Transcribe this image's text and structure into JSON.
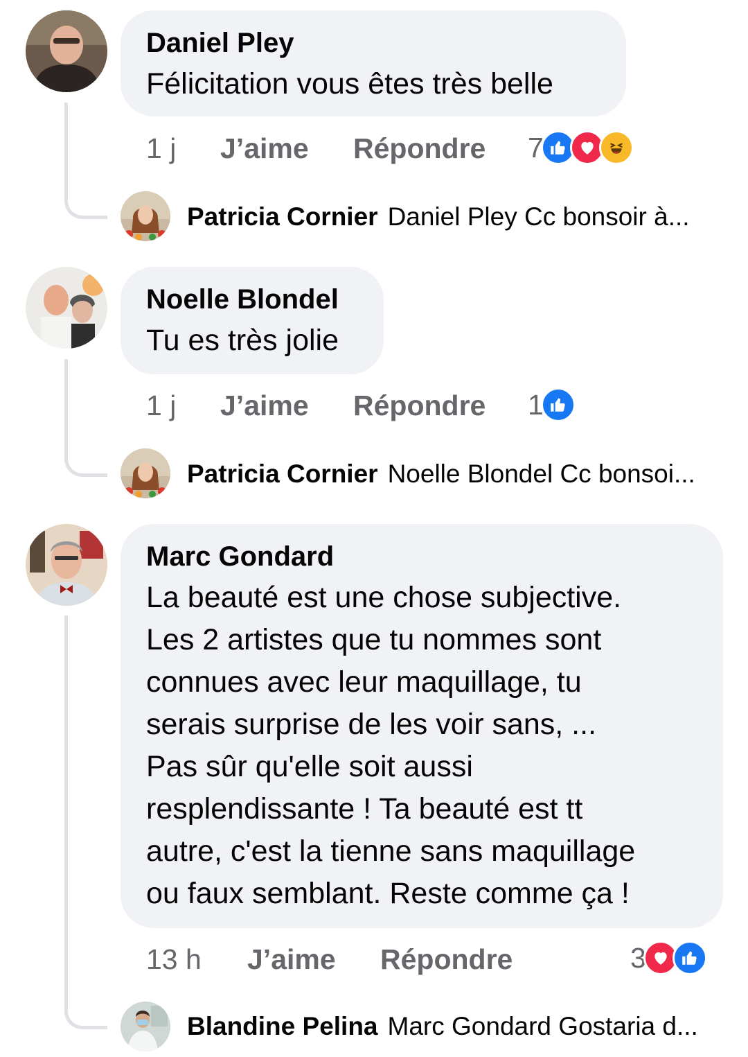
{
  "comments": [
    {
      "author": "Daniel Pley",
      "text": "Félicitation vous êtes très belle",
      "time": "1 j",
      "like_label": "J’aime",
      "reply_label": "Répondre",
      "reaction_count": "7",
      "reactions": [
        "like-icon",
        "love-icon",
        "haha-icon"
      ],
      "reply": {
        "author": "Patricia Cornier",
        "text": "Daniel Pley Cc bonsoir à..."
      }
    },
    {
      "author": "Noelle Blondel",
      "text": "Tu es très jolie",
      "time": "1 j",
      "like_label": "J’aime",
      "reply_label": "Répondre",
      "reaction_count": "1",
      "reactions": [
        "like-icon"
      ],
      "reply": {
        "author": "Patricia Cornier",
        "text": "Noelle Blondel  Cc bonsoi..."
      }
    },
    {
      "author": "Marc Gondard",
      "text": "La beauté est une chose subjective.\nLes 2 artistes que tu nommes sont\nconnues avec leur maquillage, tu\nserais surprise de les voir sans, ...\nPas sûr qu'elle soit aussi\nresplendissante ! Ta beauté est tt\nautre, c'est la tienne sans maquillage\nou faux semblant. Reste comme ça !",
      "time": "13 h",
      "like_label": "J’aime",
      "reply_label": "Répondre",
      "reaction_count": "3",
      "reactions": [
        "love-icon",
        "like-icon"
      ],
      "reply": {
        "author": "Blandine Pelina",
        "text": "Marc Gondard Gostaria d..."
      }
    }
  ],
  "colors": {
    "bubble": "#f0f2f5",
    "meta_text": "#65676b",
    "like": "#1877f2",
    "love": "#f0284a",
    "haha": "#f7b928"
  }
}
